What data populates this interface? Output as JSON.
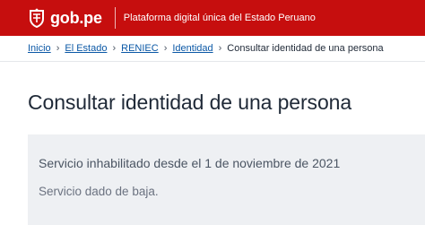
{
  "header": {
    "logo_text": "gob.pe",
    "tagline": "Plataforma digital única del Estado Peruano",
    "background_color": "#c60e0e"
  },
  "breadcrumb": {
    "items": [
      {
        "label": "Inicio"
      },
      {
        "label": "El Estado"
      },
      {
        "label": "RENIEC"
      },
      {
        "label": "Identidad"
      }
    ],
    "current": "Consultar identidad de una persona",
    "separator": "›"
  },
  "main": {
    "title": "Consultar identidad de una persona",
    "notice": {
      "title": "Servicio inhabilitado desde el 1 de noviembre de 2021",
      "body": "Servicio dado de baja."
    }
  }
}
